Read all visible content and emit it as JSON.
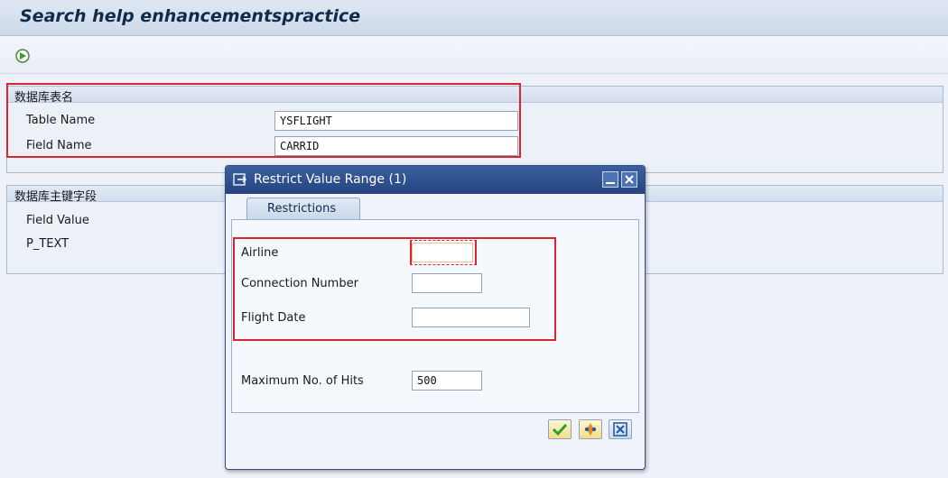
{
  "window": {
    "title": "Search help enhancementspractice"
  },
  "toolbar": {
    "execute_icon": "execute-icon"
  },
  "group_table": {
    "title": "数据库表名",
    "fields": [
      {
        "label": "Table Name",
        "value": "YSFLIGHT"
      },
      {
        "label": "Field Name",
        "value": "CARRID"
      }
    ]
  },
  "group_key": {
    "title": "数据库主键字段",
    "fields": [
      {
        "label": "Field Value"
      },
      {
        "label": "P_TEXT"
      }
    ]
  },
  "dialog": {
    "title": "Restrict Value Range (1)",
    "tab_label": "Restrictions",
    "fields": [
      {
        "label": "Airline",
        "value": ""
      },
      {
        "label": "Connection Number",
        "value": ""
      },
      {
        "label": "Flight Date",
        "value": ""
      }
    ],
    "max_hits": {
      "label": "Maximum No. of Hits",
      "value": "500"
    },
    "buttons": {
      "confirm_icon": "checkmark-icon",
      "multiple_selection_icon": "multiple-selection-icon",
      "cancel_icon": "cancel-icon"
    }
  },
  "colors": {
    "highlight": "#d9252e",
    "dialog_title": "#2b4d8c",
    "confirm": "#2e9e2e",
    "cancel": "#2a5a9e"
  }
}
